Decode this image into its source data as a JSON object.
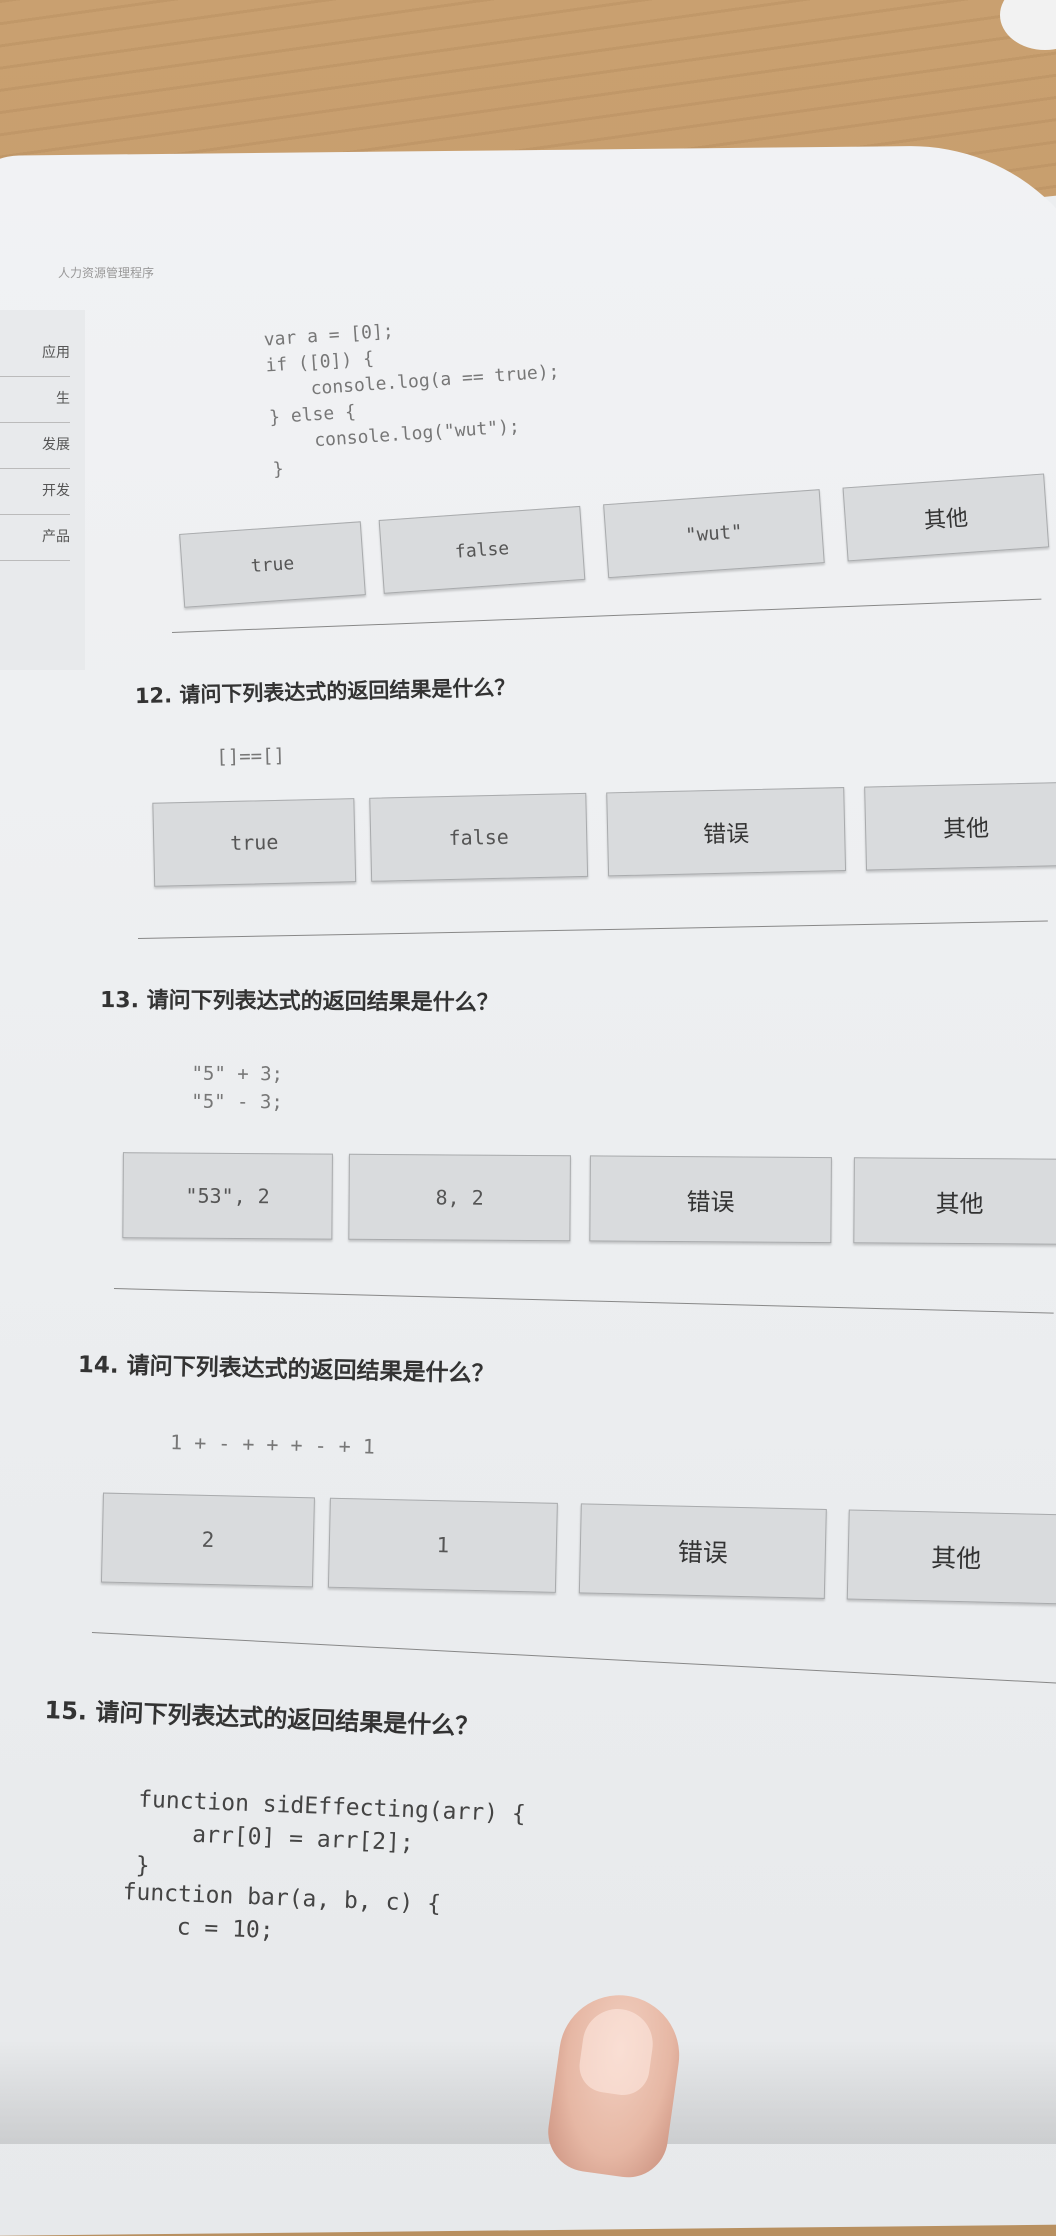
{
  "running_head": "人力资源管理程序",
  "left_page": [
    "应用",
    "生",
    "发展",
    "开发",
    "产品"
  ],
  "q11": {
    "code": [
      "var a = [0];",
      "if ([0]) {",
      "    console.log(a == true);",
      "} else {",
      "    console.log(\"wut\");",
      "}"
    ],
    "options": [
      "true",
      "false",
      "\"wut\"",
      "其他"
    ]
  },
  "q12": {
    "title": "12. 请问下列表达式的返回结果是什么？",
    "code": [
      "[]==[]"
    ],
    "options": [
      "true",
      "false",
      "错误",
      "其他"
    ]
  },
  "q13": {
    "title": "13. 请问下列表达式的返回结果是什么？",
    "code": [
      "\"5\" + 3;",
      "\"5\" - 3;"
    ],
    "options": [
      "\"53\", 2",
      "8, 2",
      "错误",
      "其他"
    ]
  },
  "q14": {
    "title": "14. 请问下列表达式的返回结果是什么？",
    "code": [
      "1 + - + + + - + 1"
    ],
    "options": [
      "2",
      "1",
      "错误",
      "其他"
    ]
  },
  "q15": {
    "title": "15. 请问下列表达式的返回结果是什么？",
    "code": [
      "function sidEffecting(arr) {",
      "    arr[0] = arr[2];",
      "}",
      "function bar(a, b, c) {",
      "    c = 10;"
    ]
  }
}
